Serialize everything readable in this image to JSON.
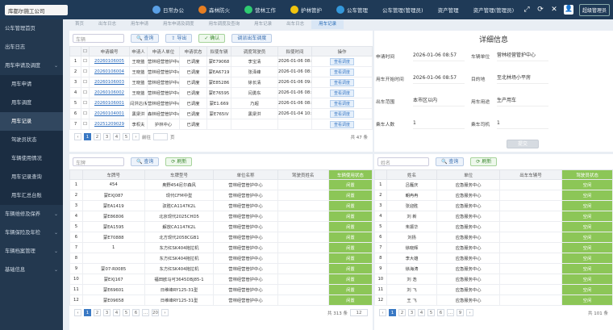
{
  "app": {
    "org": "库都尔施工公司"
  },
  "nav": [
    {
      "label": "日常办公",
      "color": "#5aa0e6"
    },
    {
      "label": "森林防火",
      "color": "#e67e22"
    },
    {
      "label": "营林工作",
      "color": "#2ecc71"
    },
    {
      "label": "护林管护",
      "color": "#f1c40f"
    },
    {
      "label": "公车管理",
      "color": "#3498db"
    },
    {
      "label": "公车管理(管理员)",
      "color": ""
    },
    {
      "label": "资产管理",
      "color": ""
    },
    {
      "label": "资产管理(管理员)",
      "color": ""
    }
  ],
  "user": {
    "name": "超级管理员"
  },
  "sidebar": [
    {
      "label": "公车管理首页",
      "type": "top"
    },
    {
      "label": "出车日志",
      "type": "top"
    },
    {
      "label": "用车申请及调度",
      "type": "group"
    },
    {
      "label": "用车申请",
      "type": "sub"
    },
    {
      "label": "用车调度",
      "type": "sub"
    },
    {
      "label": "用车记录",
      "type": "sub-active"
    },
    {
      "label": "驾驶员状态",
      "type": "sub"
    },
    {
      "label": "车辆使用情况",
      "type": "sub"
    },
    {
      "label": "用车记录查询",
      "type": "sub"
    },
    {
      "label": "用车汇总台账",
      "type": "sub"
    },
    {
      "label": "车辆维修及保养",
      "type": "group"
    },
    {
      "label": "车辆保险及年检",
      "type": "group"
    },
    {
      "label": "车辆档案管理",
      "type": "group"
    },
    {
      "label": "基础信息",
      "type": "group"
    }
  ],
  "tabs": [
    {
      "label": "首页"
    },
    {
      "label": "出车日志"
    },
    {
      "label": "用车申请"
    },
    {
      "label": "用车申请及调度"
    },
    {
      "label": "用车调度及查询"
    },
    {
      "label": "用车记录"
    },
    {
      "label": "出车日志"
    },
    {
      "label": "用车记录",
      "active": true
    }
  ],
  "top_left": {
    "search_placeholder": "车辆",
    "query": "查询",
    "export": "导出",
    "confirm": "确认",
    "dispatch": "调派出车调度",
    "columns": [
      "申请编号",
      "申请人",
      "申请人单位",
      "申请状态",
      "拟使车辆",
      "调度驾驶员",
      "拟使时间",
      "操作"
    ],
    "rows": [
      [
        "20260106005",
        "王晓蓝",
        "营林经营管护中心",
        "已调度",
        "蒙E79068",
        "李宝清",
        "2026-01-06 08:56",
        "查看调度"
      ],
      [
        "20260106004",
        "王晓蓝",
        "营林经营管护中心",
        "已调度",
        "蒙EA6719",
        "张泽峰",
        "2026-01-06 08:57",
        "查看调度"
      ],
      [
        "20260106003",
        "王晓蓝",
        "营林经营管护中心",
        "已调度",
        "蒙E85286",
        "徐长清",
        "2026-01-06 09:07",
        "查看调度"
      ],
      [
        "20260106002",
        "王晓蓝",
        "营林经营管护中心",
        "已调度",
        "蒙E76595",
        "闫勇东",
        "2026-01-06 08:53",
        "查看调度"
      ],
      [
        "20260106001",
        "闫洪达(私家)",
        "营林经营管护中心",
        "已调度",
        "蒙E1.669",
        "乃超",
        "2026-01-06 08:53",
        "查看调度"
      ],
      [
        "20260104001",
        "黑梁洪",
        "森林经营管护中心办",
        "已调度",
        "蒙E765IV",
        "黑梁洪",
        "2026-01-04 10:36",
        "查看调度"
      ],
      [
        "20251209029",
        "李权夫",
        "护林中心",
        "已调度",
        "",
        "",
        "",
        "查看调度"
      ]
    ],
    "pager": {
      "pages": [
        "1",
        "2",
        "3",
        "4",
        "5"
      ],
      "goto": "前往",
      "page": "页",
      "total": "共 47 条"
    }
  },
  "detail": {
    "title": "详细信息",
    "apply_time_label": "申请时间",
    "apply_time": "2026-01-06 08:57",
    "unit_label": "车辆单位",
    "unit": "营林经营管护中心",
    "start_label": "用车开始时间",
    "start": "2026-01-06 08:57",
    "dest_label": "目的地",
    "dest": "至北林场小平房",
    "scope_label": "出车范围",
    "scope": "本市区以内",
    "purpose_label": "用车用途",
    "purpose": "生产用车",
    "count_label": "乘车人数",
    "count": "1",
    "seats_label": "乘车司机",
    "seats": "1",
    "submit": "提交"
  },
  "bottom_left": {
    "search_placeholder": "车牌",
    "query": "查询",
    "refresh": "刷新",
    "columns": [
      "车牌号",
      "车牌型号",
      "单位名称",
      "驾驶员姓名",
      "车辆使用状态"
    ],
    "rows": [
      [
        "454",
        "奥野454尼尔森风",
        "营林经营管护中心",
        "",
        "闲置"
      ],
      [
        "蒙EXJ087",
        "现代CFM中型",
        "营林经营管护中心",
        "",
        "闲置"
      ],
      [
        "蒙EA1419",
        "驭胜CA1147K2L",
        "营林经营管护中心",
        "",
        "闲置"
      ],
      [
        "蒙E86806",
        "北京现代2025CHD5",
        "营林经营管护中心",
        "",
        "闲置"
      ],
      [
        "蒙EA1595",
        "解放CA1147K2L",
        "营林经营管护中心",
        "",
        "闲置"
      ],
      [
        "蒙E70888",
        "北方现代2058CGB1",
        "营林经营管护中心",
        "",
        "闲置"
      ],
      [
        "1",
        "东方红SK404拖拉机",
        "营林经营管护中心",
        "",
        "闲置"
      ],
      [
        "",
        "东方红SK404拖拉机",
        "营林经营管护中心",
        "",
        "闲置"
      ],
      [
        "蒙07-R0085",
        "东方红SK404拖拉机",
        "营林经营管护中心",
        "",
        "闲置"
      ],
      [
        "蒙EXJ167",
        "福田欧马可3645DBJ85-1",
        "营林经营管护中心",
        "",
        "闲置"
      ],
      [
        "蒙E69601",
        "日维峰RY125-31型",
        "营林经营管护中心",
        "",
        "闲置"
      ],
      [
        "蒙E09658",
        "日维峰RY125-31型",
        "营林经营管护中心",
        "",
        "闲置"
      ]
    ],
    "pager": {
      "pages": [
        "1",
        "2",
        "3",
        "4",
        "5",
        "6",
        "...",
        "20"
      ],
      "total": "共 313 条",
      "size": "12"
    }
  },
  "bottom_right": {
    "search_placeholder": "姓名",
    "query": "查询",
    "refresh": "刷新",
    "columns": [
      "姓名",
      "单位",
      "出车车辆号",
      "驾驶员状态"
    ],
    "rows": [
      [
        "吕雁庆",
        "应急服务中心",
        "",
        "空闲"
      ],
      [
        "朝冉冉",
        "应急服务中心",
        "",
        "空闲"
      ],
      [
        "张迎胜",
        "应急服务中心",
        "",
        "空闲"
      ],
      [
        "刘  新",
        "应急服务中心",
        "",
        "空闲"
      ],
      [
        "朱振华",
        "应急服务中心",
        "",
        "空闲"
      ],
      [
        "刘扬",
        "应急服务中心",
        "",
        "空闲"
      ],
      [
        "徐晓辉",
        "应急服务中心",
        "",
        "空闲"
      ],
      [
        "李大雄",
        "应急服务中心",
        "",
        "空闲"
      ],
      [
        "徐海涛",
        "应急服务中心",
        "",
        "空闲"
      ],
      [
        "刘  浩",
        "应急服务中心",
        "",
        "空闲"
      ],
      [
        "刘  飞",
        "应急服务中心",
        "",
        "空闲"
      ],
      [
        "王  飞",
        "应急服务中心",
        "",
        "空闲"
      ]
    ],
    "pager": {
      "pages": [
        "1",
        "2",
        "3",
        "4",
        "5",
        "6",
        "...",
        "9"
      ],
      "total": "共 101 条"
    }
  }
}
